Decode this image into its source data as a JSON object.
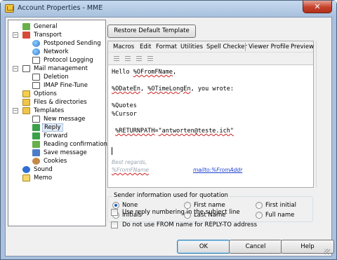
{
  "window": {
    "title": "Account Properties - MME",
    "close_glyph": "✕"
  },
  "tree": {
    "items": [
      {
        "label": "General",
        "icon": "general-icon"
      },
      {
        "label": "Transport",
        "icon": "transport-icon",
        "expander": "−"
      },
      {
        "label": "Postponed Sending",
        "icon": "postponed-icon"
      },
      {
        "label": "Network",
        "icon": "network-icon"
      },
      {
        "label": "Protocol Logging",
        "icon": "protocol-logging-icon"
      },
      {
        "label": "Mail management",
        "icon": "mail-management-icon",
        "expander": "−"
      },
      {
        "label": "Deletion",
        "icon": "deletion-icon"
      },
      {
        "label": "IMAP Fine-Tune",
        "icon": "imap-icon"
      },
      {
        "label": "Options",
        "icon": "options-icon"
      },
      {
        "label": "Files & directories",
        "icon": "files-icon"
      },
      {
        "label": "Templates",
        "icon": "templates-icon",
        "expander": "−"
      },
      {
        "label": "New message",
        "icon": "new-message-icon"
      },
      {
        "label": "Reply",
        "icon": "reply-icon"
      },
      {
        "label": "Forward",
        "icon": "forward-icon"
      },
      {
        "label": "Reading confirmation",
        "icon": "reading-confirmation-icon"
      },
      {
        "label": "Save message",
        "icon": "save-message-icon"
      },
      {
        "label": "Cookies",
        "icon": "cookies-icon"
      },
      {
        "label": "Sound",
        "icon": "sound-icon"
      },
      {
        "label": "Memo",
        "icon": "memo-icon"
      }
    ]
  },
  "restore_button": "Restore Default Template",
  "editor": {
    "menu": [
      "Macros",
      "Edit",
      "Format",
      "Utilities",
      "Spell Checker",
      "Viewer Profile",
      "Preview"
    ],
    "lines": [
      {
        "pre": "Hello ",
        "macro": "%OFromFName",
        "post": ","
      },
      {
        "pre": "",
        "macro": "%ODateEn",
        "post": ", "
      },
      {
        "pre": "",
        "macro": "%OTimeLongEn",
        "post": ", you wrote:"
      },
      {
        "pre": "%Quotes",
        "macro": "",
        "post": ""
      },
      {
        "pre": "%Cursor",
        "macro": "",
        "post": ""
      },
      {
        "pre": " ",
        "macro": "%RETURNPATH",
        "post": "="
      },
      {
        "pre": "",
        "macro": "\"antworten@teste.ich\"",
        "post": ""
      }
    ],
    "signature": {
      "greeting": "Best regards,",
      "name_macro": "%FromFName",
      "mail_link": "mailto:%FromAddr"
    }
  },
  "sender_group": {
    "title": "Sender information used for quotation",
    "options": [
      "None",
      "First name",
      "First initial",
      "Initials",
      "Last Name",
      "Full name"
    ],
    "selected": "None"
  },
  "checkboxes": [
    {
      "label": "Use reply numbering in the subject line",
      "checked": false
    },
    {
      "label": "Do not use FROM name for REPLY-TO address",
      "checked": false
    }
  ],
  "buttons": {
    "ok": "OK",
    "cancel": "Cancel",
    "help": "Help"
  }
}
